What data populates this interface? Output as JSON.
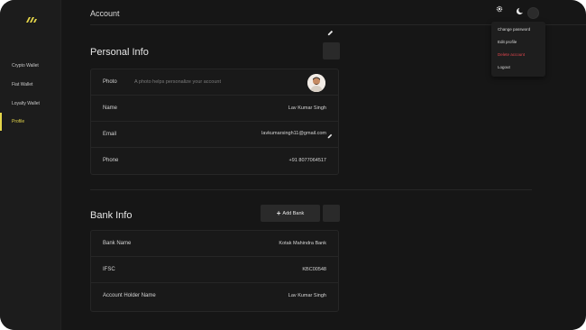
{
  "sidebar": {
    "items": [
      {
        "label": "Crypto Wallet",
        "active": false
      },
      {
        "label": "Fiat Wallet",
        "active": false
      },
      {
        "label": "Loyalty Wallet",
        "active": false
      },
      {
        "label": "Profile",
        "active": true
      }
    ],
    "accent_color": "#e4d54a"
  },
  "header": {
    "title": "Account",
    "icons": [
      "gear-icon",
      "moon-icon",
      "avatar"
    ]
  },
  "account_menu": {
    "items": [
      {
        "label": "Change password"
      },
      {
        "label": "Edit profile"
      },
      {
        "label": "Delete account",
        "danger_color": "#e0454d"
      },
      {
        "label": "Logout"
      }
    ]
  },
  "personal_info": {
    "title": "Personal Info",
    "photo": {
      "label": "Photo",
      "hint": "A photo helps personalize your account"
    },
    "name": {
      "label": "Name",
      "value": "Lav Kumar Singh"
    },
    "email": {
      "label": "Email",
      "value": "lavkumarsingh11@gmail.com"
    },
    "phone": {
      "label": "Phone",
      "value": "+91 8077064517"
    }
  },
  "bank_info": {
    "title": "Bank Info",
    "add_bank_label": "Add Bank",
    "bank_name": {
      "label": "Bank Name",
      "value": "Kotak Mahindra Bank"
    },
    "ifsc": {
      "label": "IFSC",
      "value": "KBC00548"
    },
    "holder": {
      "label": "Account Holder Name",
      "value": "Lav Kumar Singh"
    }
  }
}
